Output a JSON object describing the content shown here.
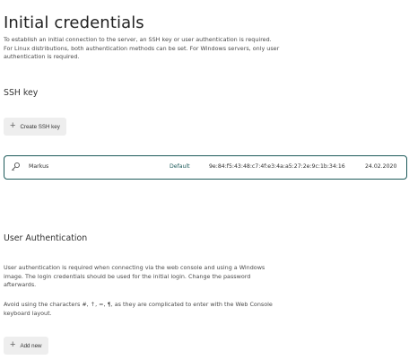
{
  "page": {
    "title": "Initial credentials"
  },
  "intro": {
    "lines": [
      "To establish an initial connection to the server, an SSH key or user authentication is required.",
      "For Linux distributions, both authentication methods can be set. For Windows servers, only user",
      "authentication is required."
    ]
  },
  "ssh": {
    "heading": "SSH key",
    "create_label": "Create SSH key",
    "key": {
      "icon": "key-icon",
      "name": "Markus",
      "default_label": "Default",
      "fingerprint": "9e:84:f5:43:48:c7:4f:e3:4a:a5:27:2e:9c:1b:34:16",
      "date": "24.02.2020"
    }
  },
  "auth": {
    "heading": "User Authentication",
    "para1_lines": [
      "User authentication is required when connecting via the web console and using a Windows",
      "image. The login credentials should be used for the initial login. Change the password",
      "afterwards."
    ],
    "para2_lines": [
      "Avoid using the characters #, ↑, =, ¶, as they are complicated to enter with the Web Console",
      "keyboard layout."
    ],
    "add_label": "Add new"
  },
  "colors": {
    "accent": "#1d5a5a",
    "button_bg": "#eeeeee",
    "text": "#333333"
  }
}
